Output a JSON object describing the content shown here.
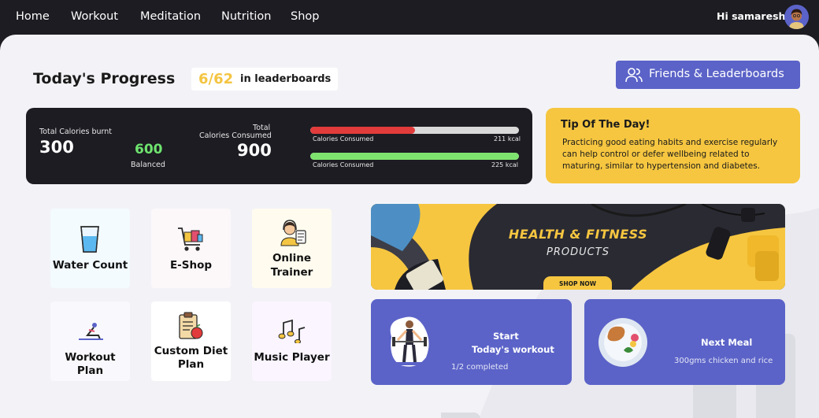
{
  "nav": {
    "items": [
      "Home",
      "Workout",
      "Meditation",
      "Nutrition",
      "Shop"
    ],
    "greeting": "Hi samaresh!"
  },
  "progress": {
    "title": "Today's Progress",
    "rank": "6/62",
    "rank_suffix": "in leaderboards",
    "friends_button": "Friends & Leaderboards"
  },
  "calories": {
    "burnt_label": "Total Calories burnt",
    "burnt_value": "300",
    "balanced_value": "600",
    "balanced_label": "Balanced",
    "consumed_label_1": "Total",
    "consumed_label_2": "Calories Consumed",
    "consumed_value": "900",
    "bars": [
      {
        "label": "Calories Consumed",
        "value": "211 kcal",
        "fraction": 0.5,
        "color": "#e23b3b"
      },
      {
        "label": "Calories Consumed",
        "value": "225 kcal",
        "fraction": 1.0,
        "color": "#7ee36e"
      }
    ]
  },
  "tip": {
    "title": "Tip Of The Day!",
    "body": "Practicing good eating habits and exercise regularly can help control or defer wellbeing related to maturing, similar to hypertension and diabetes."
  },
  "tiles": {
    "water": "Water Count",
    "eshop": "E-Shop",
    "trainer_1": "Online",
    "trainer_2": "Trainer",
    "workout_plan": "Workout Plan",
    "diet_1": "Custom Diet",
    "diet_2": "Plan",
    "music": "Music Player"
  },
  "banner": {
    "headline": "HEALTH & FITNESS",
    "sub": "PRODUCTS",
    "cta": "SHOP NOW"
  },
  "workout_card": {
    "line1": "Start",
    "line2": "Today's workout",
    "status": "1/2 completed"
  },
  "meal_card": {
    "title": "Next Meal",
    "desc": "300gms chicken and rice"
  },
  "colors": {
    "accent": "#5b63c8",
    "tip_yellow": "#f6c640",
    "rank_yellow": "#f4c542",
    "dark": "#1c1c22",
    "balanced_green": "#6ee36e"
  }
}
